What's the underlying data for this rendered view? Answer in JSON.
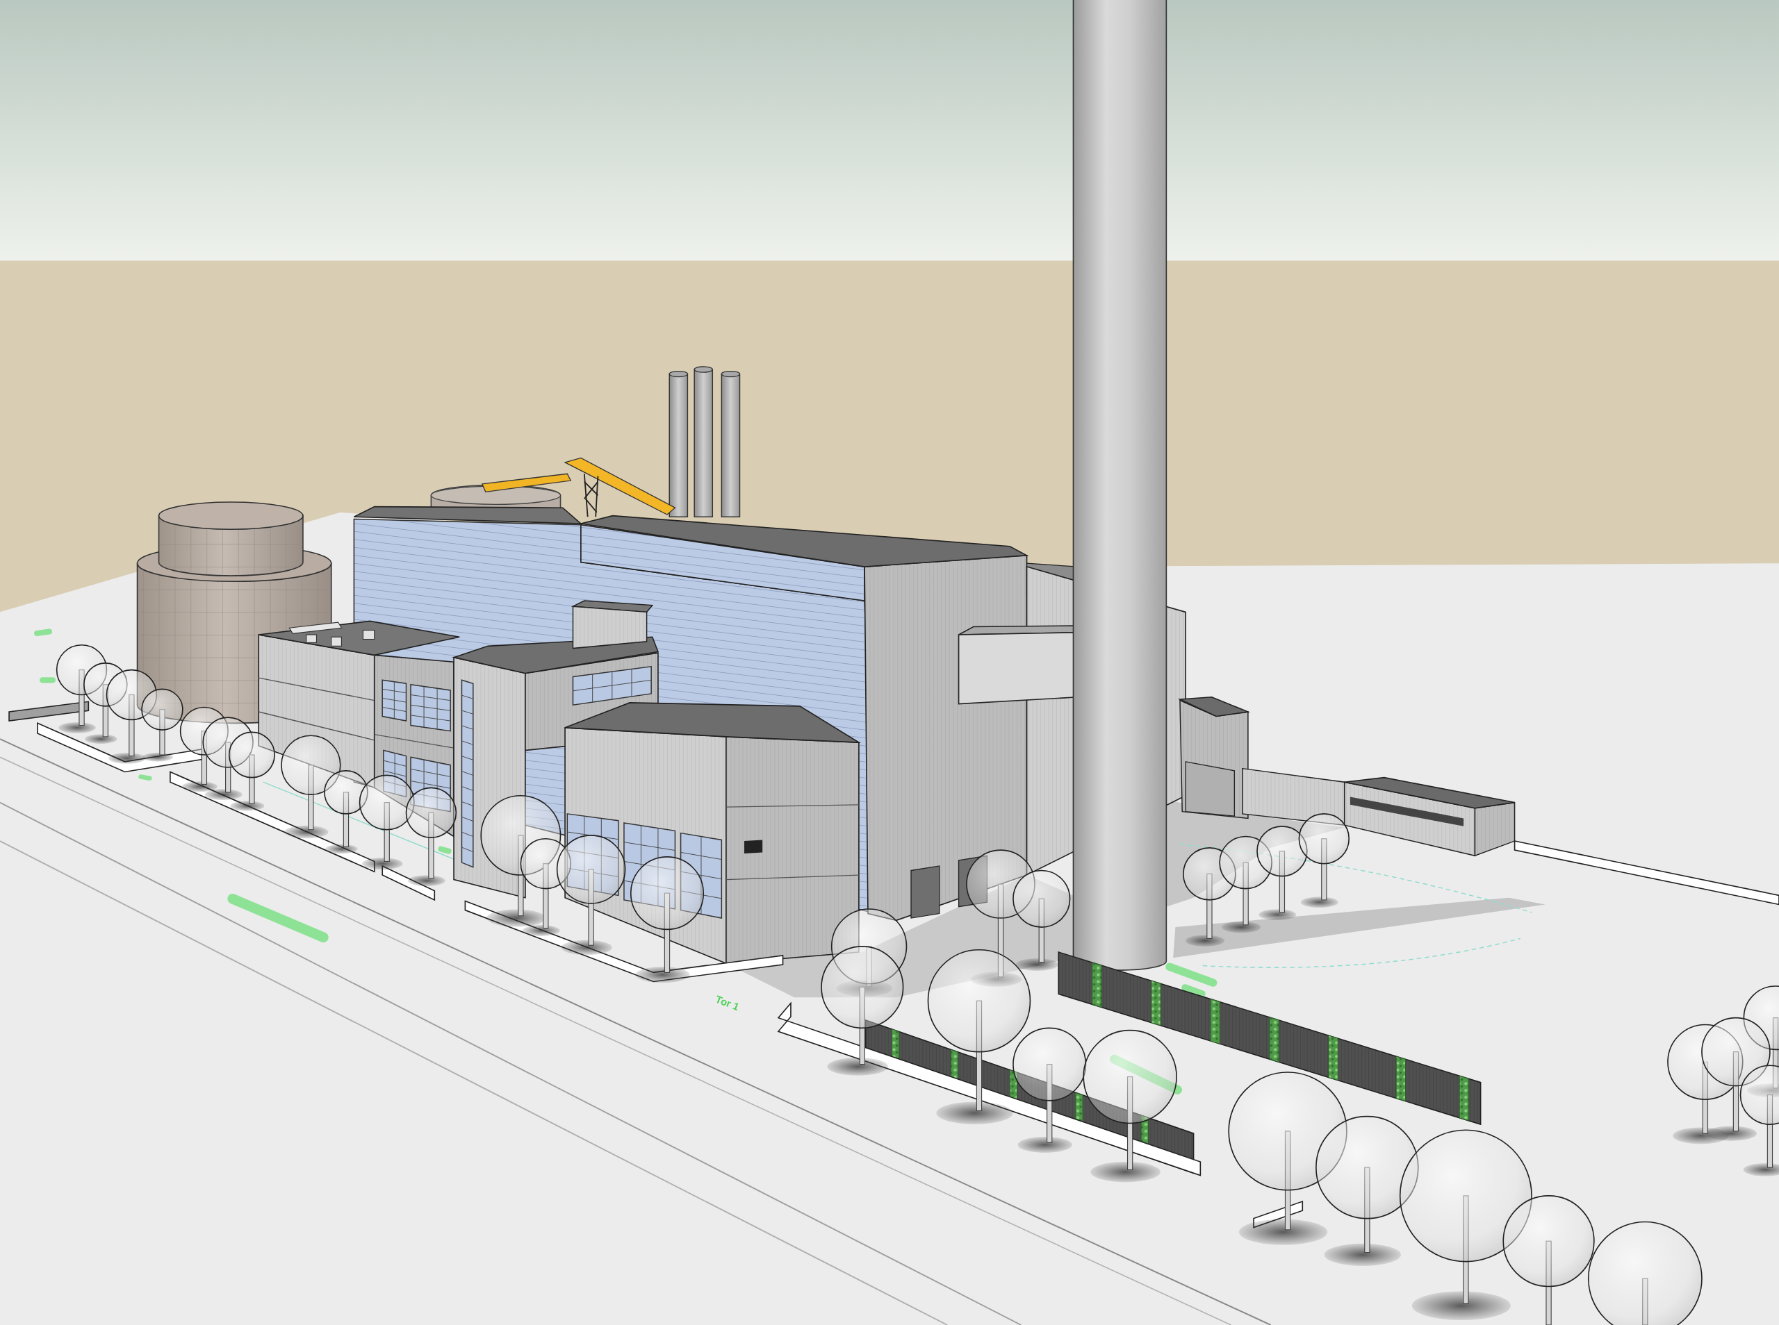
{
  "ground_labels": [
    {
      "text": "Tor 1"
    }
  ]
}
